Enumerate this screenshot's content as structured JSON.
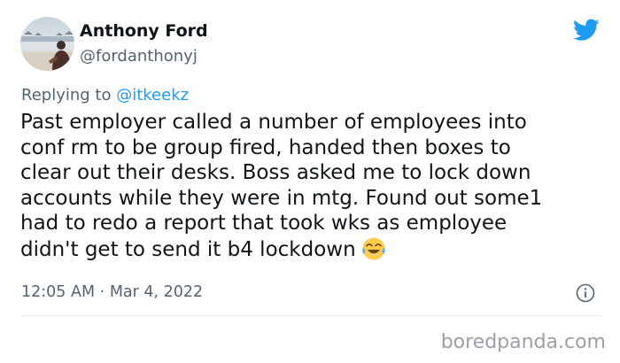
{
  "tweet": {
    "author_name": "Anthony Ford",
    "author_handle": "@fordanthonyj",
    "reply_prefix": "Replying to",
    "reply_to": "@itkeekz",
    "text_lines": [
      "Past employer called a number of employees into",
      "conf rm to be group fired, handed then boxes to",
      "clear out their desks. Boss asked me to lock down",
      "accounts while they were in mtg. Found out some1",
      "had to redo a report that took wks as employee",
      "didn't get to send it b4 lockdown"
    ],
    "emoji": "face-with-tears-of-joy-emoji",
    "time": "12:05 AM",
    "separator": "·",
    "date": "Mar 4, 2022"
  },
  "icons": {
    "brand": "twitter-bird-icon",
    "info": "info-icon"
  },
  "watermark": {
    "text": "boredpanda.com"
  },
  "colors": {
    "twitter_blue": "#1d9bf0",
    "text": "#0f1419",
    "muted": "#536471",
    "link": "#1d9bf0",
    "watermark": "#9aa0a6"
  }
}
